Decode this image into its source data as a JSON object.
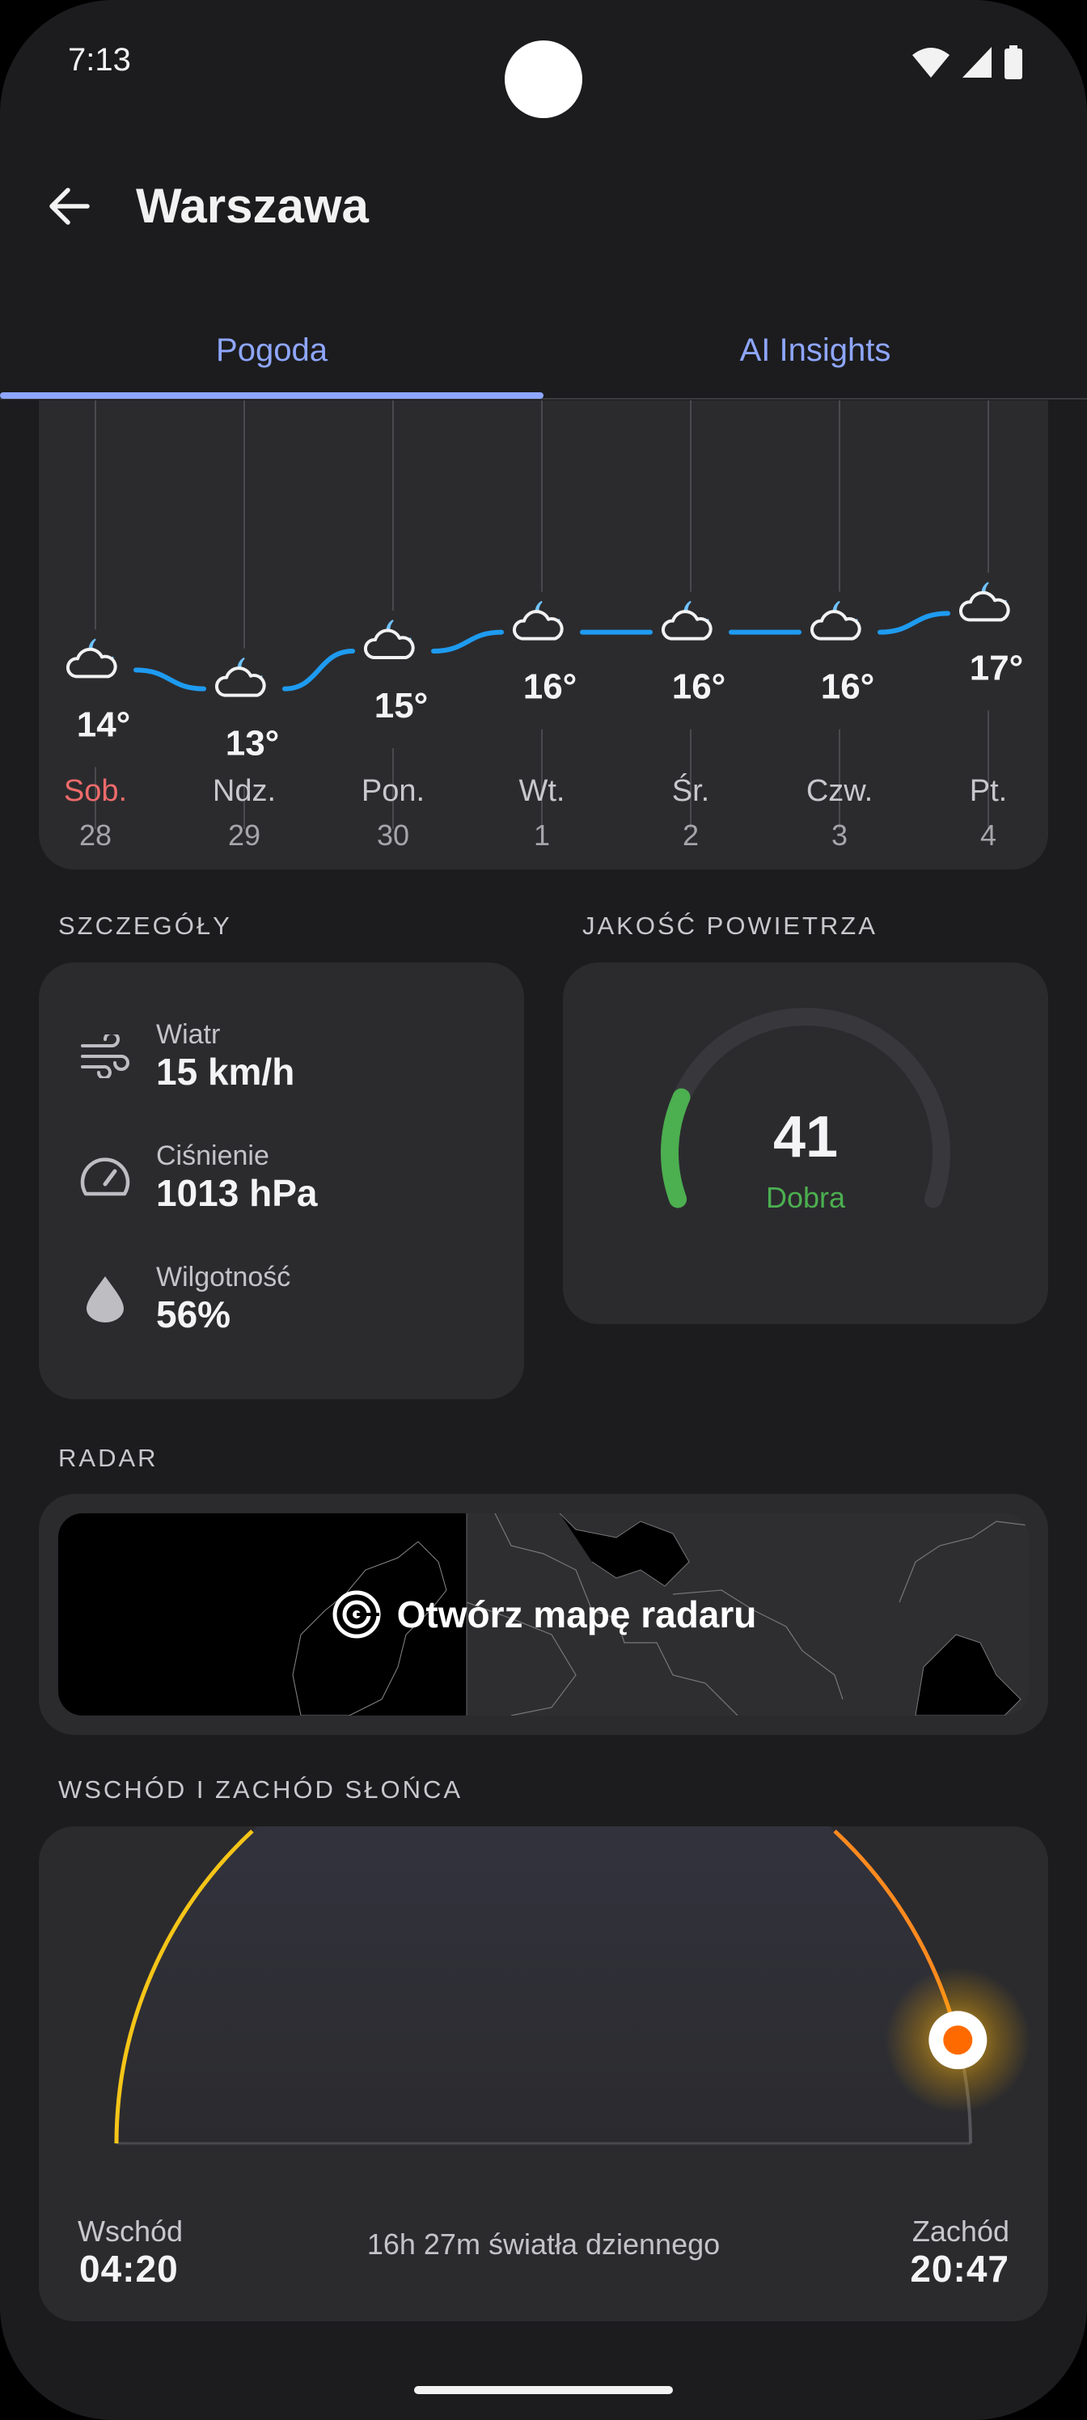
{
  "status_bar": {
    "time": "7:13"
  },
  "app_bar": {
    "title": "Warszawa"
  },
  "tabs": [
    {
      "label": "Pogoda",
      "selected": true
    },
    {
      "label": "AI Insights",
      "selected": false
    }
  ],
  "forecast": {
    "days": [
      {
        "day": "Sob.",
        "date": "28",
        "temp": "14°",
        "weekend": true
      },
      {
        "day": "Ndz.",
        "date": "29",
        "temp": "13°",
        "weekend": false
      },
      {
        "day": "Pon.",
        "date": "30",
        "temp": "15°",
        "weekend": false
      },
      {
        "day": "Wt.",
        "date": "1",
        "temp": "16°",
        "weekend": false
      },
      {
        "day": "Śr.",
        "date": "2",
        "temp": "16°",
        "weekend": false
      },
      {
        "day": "Czw.",
        "date": "3",
        "temp": "16°",
        "weekend": false
      },
      {
        "day": "Pt.",
        "date": "4",
        "temp": "17°",
        "weekend": false
      }
    ],
    "icon": "night-partly-cloudy-icon"
  },
  "details": {
    "section_label": "SZCZEGÓŁY",
    "wind": {
      "label": "Wiatr",
      "value": "15 km/h"
    },
    "pressure": {
      "label": "Ciśnienie",
      "value": "1013 hPa"
    },
    "humidity": {
      "label": "Wilgotność",
      "value": "56%"
    }
  },
  "air_quality": {
    "section_label": "JAKOŚĆ POWIETRZA",
    "value": "41",
    "label": "Dobra",
    "level": 0.2
  },
  "radar": {
    "section_label": "RADAR",
    "button_label": "Otwórz mapę radaru"
  },
  "sun": {
    "section_label": "WSCHÓD I ZACHÓD SŁOŃCA",
    "sunrise_label": "Wschód",
    "sunrise_time": "04:20",
    "sunset_label": "Zachód",
    "sunset_time": "20:47",
    "daylight": "16h 27m światła dziennego"
  },
  "colors": {
    "accent": "#8ea6ff",
    "temp_line": "#1e9bf0",
    "weekend": "#ef6b6b",
    "aqi_good": "#4caf50",
    "sunrise_arc": "#f5c518",
    "sunset_arc": "#ff8a1f",
    "sun_dot": "#ff6a00"
  }
}
